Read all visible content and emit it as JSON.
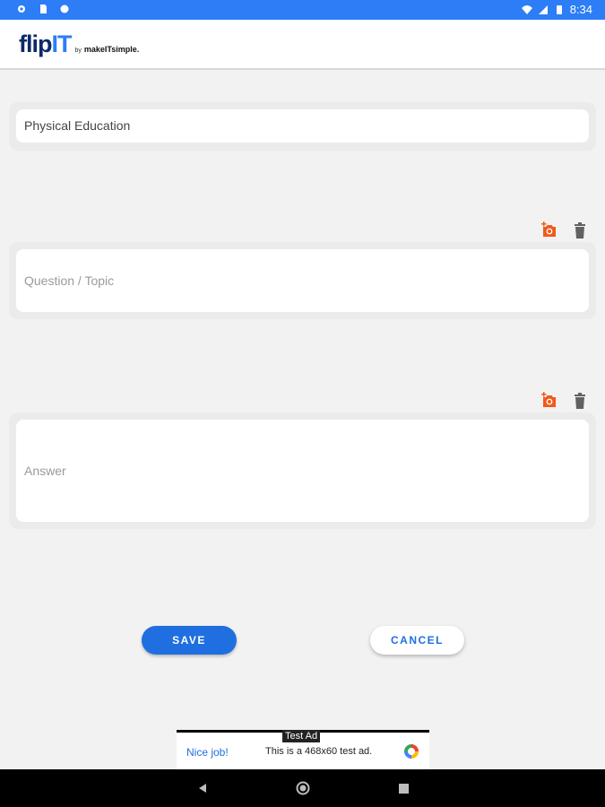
{
  "status_bar": {
    "time": "8:34",
    "left_icons": [
      "gear-icon",
      "sd-card-icon",
      "circle-icon"
    ],
    "right_icons": [
      "wifi-icon",
      "signal-icon",
      "battery-icon"
    ]
  },
  "header": {
    "logo_main": "flip",
    "logo_accent": "IT",
    "logo_by": "by",
    "logo_sub": "makeITsimple."
  },
  "form": {
    "title_field": {
      "value": "Physical Education"
    },
    "question_field": {
      "placeholder": "Question / Topic"
    },
    "answer_field": {
      "placeholder": "Answer"
    }
  },
  "icons": {
    "add_photo": "add-photo-icon",
    "delete": "trash-icon"
  },
  "buttons": {
    "save": "SAVE",
    "cancel": "CANCEL"
  },
  "ad": {
    "label": "Test Ad",
    "nice": "Nice job!",
    "text": "This is a 468x60 test ad."
  },
  "colors": {
    "status_bar": "#2d7df6",
    "brand_dark": "#0d2a66",
    "accent_blue": "#1f6fe0",
    "icon_orange": "#f2591b",
    "icon_gray": "#616161"
  }
}
